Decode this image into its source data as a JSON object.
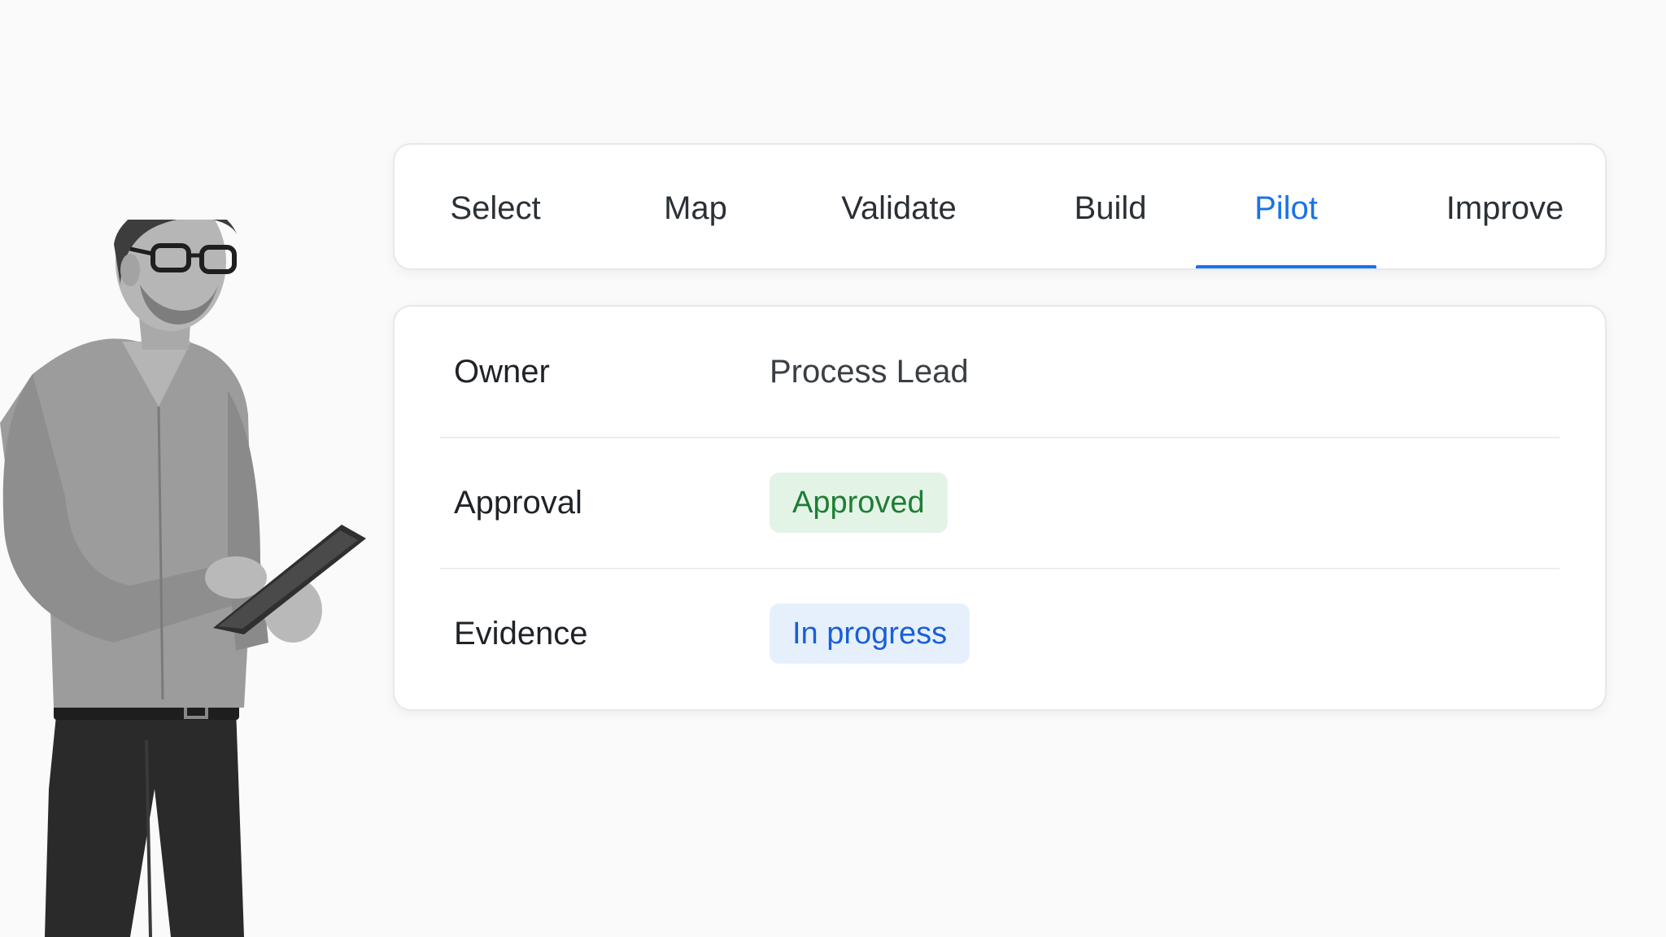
{
  "tabs": [
    {
      "label": "Select",
      "active": false
    },
    {
      "label": "Map",
      "active": false
    },
    {
      "label": "Validate",
      "active": false
    },
    {
      "label": "Build",
      "active": false
    },
    {
      "label": "Pilot",
      "active": true
    },
    {
      "label": "Improve",
      "active": false
    }
  ],
  "details": {
    "owner": {
      "label": "Owner",
      "value": "Process Lead"
    },
    "approval": {
      "label": "Approval",
      "status": "Approved",
      "status_color": "#1e7e34"
    },
    "evidence": {
      "label": "Evidence",
      "status": "In progress",
      "status_color": "#1a5fd6"
    }
  },
  "colors": {
    "accent": "#1a73e8",
    "approved_bg": "#e3f4e7",
    "in_progress_bg": "#e6f0fd"
  },
  "illustration": {
    "icon": "person-with-tablet-icon"
  }
}
